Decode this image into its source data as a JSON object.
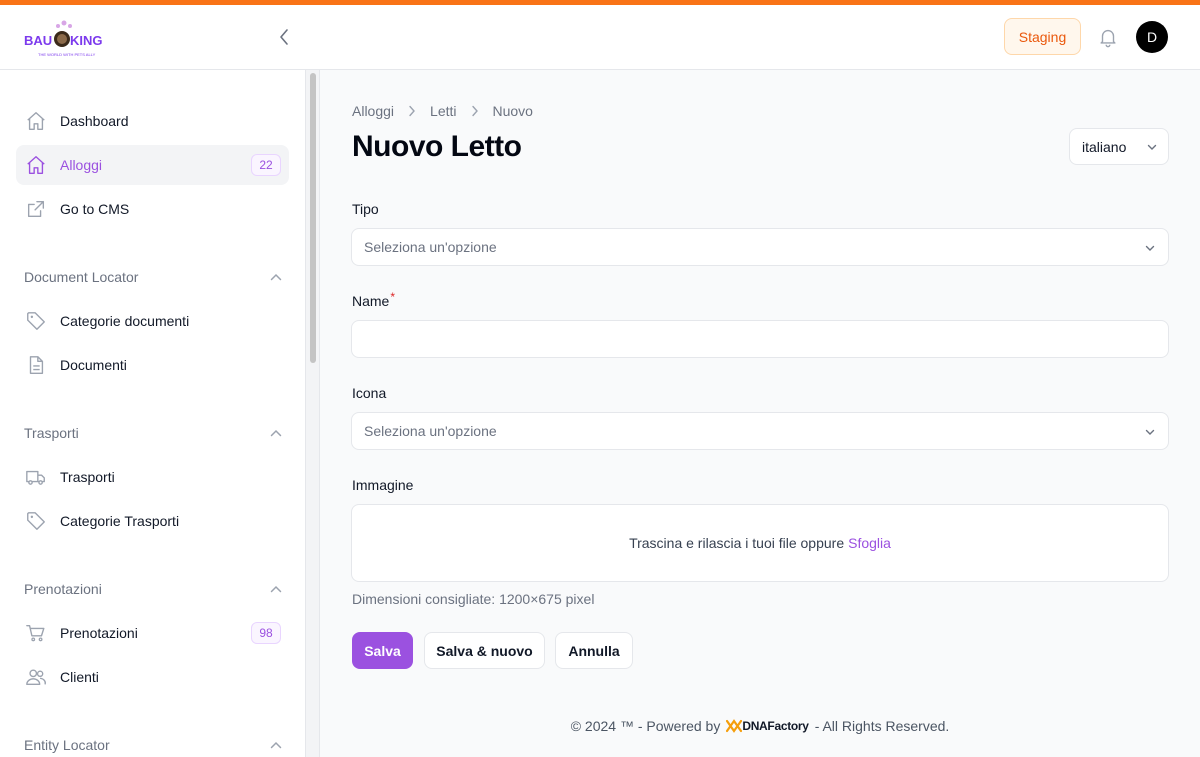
{
  "header": {
    "logo_text_left": "BAU",
    "logo_text_right": "KING",
    "logo_tagline": "THE WORLD WITH PETS ALLY",
    "environment_badge": "Staging",
    "avatar_initial": "D"
  },
  "sidebar": {
    "items": [
      {
        "label": "Dashboard",
        "icon": "home-icon"
      },
      {
        "label": "Alloggi",
        "icon": "home-icon",
        "badge": "22",
        "active": true
      },
      {
        "label": "Go to CMS",
        "icon": "external-link-icon"
      }
    ],
    "groups": [
      {
        "label": "Document Locator",
        "items": [
          {
            "label": "Categorie documenti",
            "icon": "tag-icon"
          },
          {
            "label": "Documenti",
            "icon": "document-icon"
          }
        ]
      },
      {
        "label": "Trasporti",
        "items": [
          {
            "label": "Trasporti",
            "icon": "truck-icon"
          },
          {
            "label": "Categorie Trasporti",
            "icon": "tag-icon"
          }
        ]
      },
      {
        "label": "Prenotazioni",
        "items": [
          {
            "label": "Prenotazioni",
            "icon": "cart-icon",
            "badge": "98"
          },
          {
            "label": "Clienti",
            "icon": "users-icon"
          }
        ]
      },
      {
        "label": "Entity Locator",
        "items": []
      }
    ]
  },
  "main": {
    "breadcrumb": [
      "Alloggi",
      "Letti",
      "Nuovo"
    ],
    "title": "Nuovo Letto",
    "language": "italiano",
    "form": {
      "tipo_label": "Tipo",
      "tipo_placeholder": "Seleziona un'opzione",
      "name_label": "Name",
      "name_required": "*",
      "name_value": "",
      "icona_label": "Icona",
      "icona_placeholder": "Seleziona un'opzione",
      "immagine_label": "Immagine",
      "dropzone_text": "Trascina e rilascia i tuoi file oppure",
      "dropzone_browse": "Sfoglia",
      "hint": "Dimensioni consigliate: 1200×675 pixel"
    },
    "buttons": {
      "save": "Salva",
      "save_new": "Salva & nuovo",
      "cancel": "Annulla"
    }
  },
  "footer": {
    "left": "© 2024 ™ - Powered by",
    "brand": "DNAFactory",
    "right": "- All Rights Reserved."
  },
  "colors": {
    "accent": "#9b51e0",
    "top_bar": "#f97316",
    "staging": "#ea580c"
  }
}
